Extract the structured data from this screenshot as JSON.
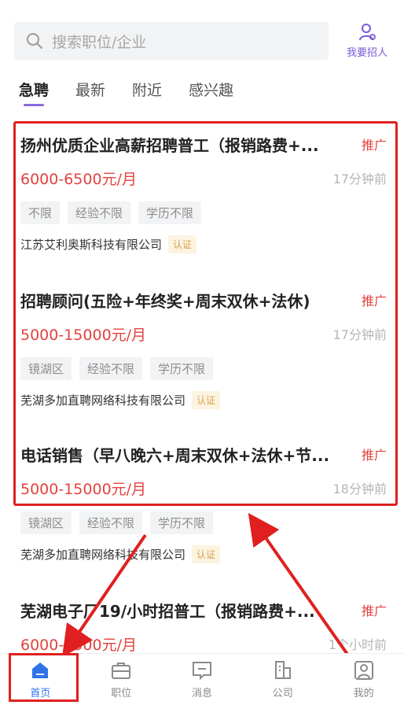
{
  "search": {
    "placeholder": "搜索职位/企业"
  },
  "header": {
    "recruit_label": "我要招人"
  },
  "tabs": [
    {
      "label": "急聘",
      "active": true
    },
    {
      "label": "最新",
      "active": false
    },
    {
      "label": "附近",
      "active": false
    },
    {
      "label": "感兴趣",
      "active": false
    }
  ],
  "jobs": [
    {
      "title": "扬州优质企业高薪招聘普工（报销路费+...",
      "promo": "推广",
      "salary": "6000-6500元/月",
      "posted": "17分钟前",
      "tags": [
        "不限",
        "经验不限",
        "学历不限"
      ],
      "company": "江苏艾利奥斯科技有限公司",
      "verified": "认证"
    },
    {
      "title": "招聘顾问(五险+年终奖+周末双休+法休)",
      "promo": "推广",
      "salary": "5000-15000元/月",
      "posted": "17分钟前",
      "tags": [
        "镜湖区",
        "经验不限",
        "学历不限"
      ],
      "company": "芜湖多加直聘网络科技有限公司",
      "verified": "认证"
    },
    {
      "title": "电话销售（早八晚六+周末双休+法休+节...",
      "promo": "推广",
      "salary": "5000-15000元/月",
      "posted": "18分钟前",
      "tags": [
        "镜湖区",
        "经验不限",
        "学历不限"
      ],
      "company": "芜湖多加直聘网络科技有限公司",
      "verified": "认证"
    },
    {
      "title": "芜湖电子厂19/小时招普工（报销路费+...",
      "promo": "推广",
      "salary": "6000-6500元/月",
      "posted": "1个小时前"
    }
  ],
  "nav": [
    {
      "label": "首页",
      "icon": "home-icon",
      "active": true
    },
    {
      "label": "职位",
      "icon": "briefcase-icon",
      "active": false
    },
    {
      "label": "消息",
      "icon": "message-icon",
      "active": false
    },
    {
      "label": "公司",
      "icon": "building-icon",
      "active": false
    },
    {
      "label": "我的",
      "icon": "profile-icon",
      "active": false
    }
  ],
  "colors": {
    "accent": "#8b69e0",
    "salary": "#e2433f",
    "nav_active": "#2d74e8",
    "annotation": "#e02020"
  }
}
